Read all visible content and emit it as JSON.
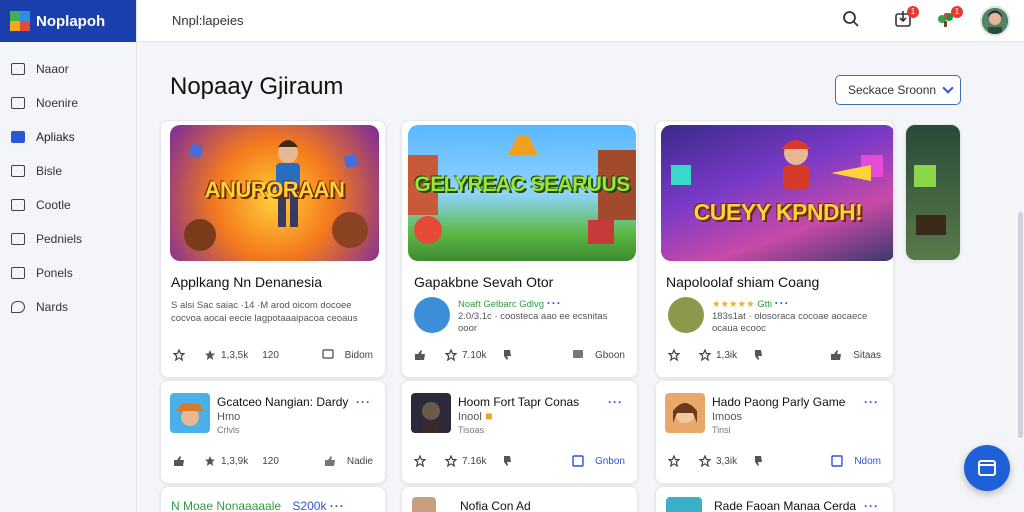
{
  "app": {
    "name": "Noplapoh"
  },
  "sidebar": {
    "items": [
      {
        "label": "Naaor",
        "icon": "file-icon"
      },
      {
        "label": "Noenire",
        "icon": "list-icon"
      },
      {
        "label": "Apliaks",
        "icon": "card-icon",
        "active": true
      },
      {
        "label": "Bisle",
        "icon": "image-icon"
      },
      {
        "label": "Cootle",
        "icon": "doc-icon"
      },
      {
        "label": "Pedniels",
        "icon": "pages-icon"
      },
      {
        "label": "Ponels",
        "icon": "panel-icon"
      },
      {
        "label": "Nards",
        "icon": "chat-icon"
      }
    ]
  },
  "topbar": {
    "breadcrumb": "Nnpl:lapeies",
    "download_badge": "1",
    "notif_badge": "1"
  },
  "main": {
    "title": "Nopaay Gjiraum",
    "sort_label": "Seckace Sroonn"
  },
  "featured": [
    {
      "banner_text": "ANURORAAN",
      "title": "Applkang Nn Denanesia",
      "description": "S alsi Sac saiac ·14 ·M arod oicom docoee cocvoa aocai eecie lagpotaaaipacoa ceoaus",
      "stats": {
        "likes": "1,3,5k",
        "count": "120",
        "action": "Bidom"
      }
    },
    {
      "banner_text": "GELYREAC SEARUUS",
      "title": "Gapakbne Sevah Otor",
      "dev_name": "Noaft Gelbarc Gdlvg",
      "dev_meta": "2.0/3.1c · coosteca aao ee ecsnitas ooor",
      "stats": {
        "likes": "7.10k",
        "action": "Gboon"
      }
    },
    {
      "banner_text": "CUEYY KPNDH!",
      "title": "Napoloolaf shiam Coang",
      "dev_name": "Gtti",
      "dev_meta": "183s1at · olosoraca cocoae aocaece ocaua ecooc",
      "stats": {
        "likes": "1,3ik",
        "action": "Sitaas"
      }
    }
  ],
  "list": [
    {
      "title": "Gcatceo Nangian: Dardy",
      "sub": "Hmo",
      "meta": "Crlvls",
      "likes": "1,3,9k",
      "count": "120",
      "action": "Nadie"
    },
    {
      "title": "Hoom Fort Tapr Conas",
      "sub": "Inool",
      "meta": "Tisoas",
      "likes": "7.16k",
      "action": "Gnbon"
    },
    {
      "title": "Hado Paong Parly Game",
      "sub": "Imoos",
      "meta": "Tinsl",
      "likes": "3,3ik",
      "action": "Ndom"
    }
  ],
  "list_partial": [
    {
      "title": "N Moae Nonaaaaale",
      "price": "S200k"
    },
    {
      "title": "Nofia Con Ad"
    },
    {
      "title": "Rade Faoan Manaa Cerda"
    }
  ],
  "colors": {
    "brand": "#1c3fae",
    "accent": "#2b56d6",
    "fab": "#1f5fd8",
    "badge": "#e53935"
  }
}
